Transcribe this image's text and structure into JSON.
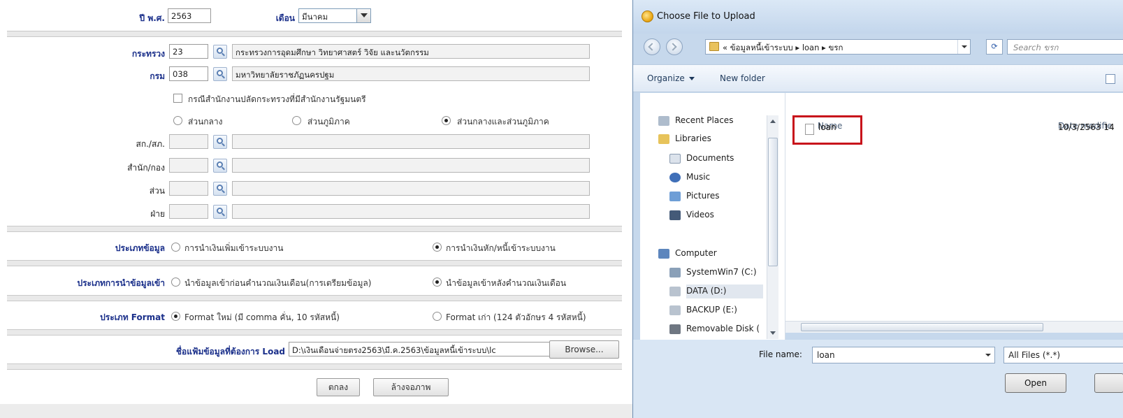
{
  "form": {
    "year_label": "ปี พ.ศ.",
    "year_value": "2563",
    "month_label": "เดือน",
    "month_value": "มีนาคม",
    "ministry_label": "กระทรวง",
    "ministry_code": "23",
    "ministry_name": "กระทรวงการอุดมศึกษา วิทยาศาสตร์ วิจัย และนวัตกรรม",
    "dept_label": "กรม",
    "dept_code": "038",
    "dept_name": "มหาวิทยาลัยราชภัฏนครปฐม",
    "pm_checkbox_label": "กรณีสำนักงานปลัดกระทรวงที่มีสำนักงานรัฐมนตรี",
    "region_options": [
      "ส่วนกลาง",
      "ส่วนภูมิภาค",
      "ส่วนกลางและส่วนภูมิภาค"
    ],
    "region_selected": 2,
    "sk_label": "สก./สภ.",
    "office_label": "สำนัก/กอง",
    "section_label": "ส่วน",
    "division_label": "ฝ่าย",
    "data_type_label": "ประเภทข้อมูล",
    "data_type_options": [
      "การนำเงินเพิ่มเข้าระบบงาน",
      "การนำเงินหัก/หนี้เข้าระบบงาน"
    ],
    "data_type_selected": 1,
    "import_type_label": "ประเภทการนำข้อมูลเข้า",
    "import_type_options": [
      "นำข้อมูลเข้าก่อนคำนวณเงินเดือน(การเตรียมข้อมูล)",
      "นำข้อมูลเข้าหลังคำนวณเงินเดือน"
    ],
    "import_type_selected": 1,
    "format_label": "ประเภท Format",
    "format_options": [
      "Format ใหม่ (มี comma คั่น, 10 รหัสหนี้)",
      "Format เก่า (124 ตัวอักษร 4 รหัสหนี้)"
    ],
    "format_selected": 0,
    "file_label": "ชื่อแฟ้มข้อมูลที่ต้องการ Load",
    "file_path": "D:\\เงินเดือนจ่ายตรง2563\\มี.ค.2563\\ข้อมูลหนี้เข้าระบบ\\lc",
    "browse_label": "Browse...",
    "ok_label": "ตกลง",
    "clear_label": "ล้างจอภาพ"
  },
  "dialog": {
    "title": "Choose File to Upload",
    "address": "« ข้อมูลหนี้เข้าระบบ ▸ loan ▸ ขรก",
    "search_placeholder": "Search ขรก",
    "organize_label": "Organize",
    "new_folder_label": "New folder",
    "nav_items": [
      {
        "label": "Recent Places",
        "icon": "recent-places-icon"
      },
      {
        "label": "Libraries",
        "icon": "libraries-icon"
      },
      {
        "label": "Documents",
        "icon": "documents-icon"
      },
      {
        "label": "Music",
        "icon": "music-icon"
      },
      {
        "label": "Pictures",
        "icon": "pictures-icon"
      },
      {
        "label": "Videos",
        "icon": "videos-icon"
      },
      {
        "label": "Computer",
        "icon": "computer-icon"
      },
      {
        "label": "SystemWin7 (C:)",
        "icon": "drive-icon"
      },
      {
        "label": "DATA (D:)",
        "icon": "drive-icon"
      },
      {
        "label": "BACKUP (E:)",
        "icon": "drive-icon"
      },
      {
        "label": "Removable Disk (",
        "icon": "removable-drive-icon"
      }
    ],
    "col_name": "Name",
    "col_date": "Date modifie",
    "files": [
      {
        "name": "loan",
        "date": "10/3/2563 14"
      }
    ],
    "file_name_label": "File name:",
    "file_name_value": "loan",
    "filter_value": "All Files (*.*)",
    "open_label": "Open"
  }
}
